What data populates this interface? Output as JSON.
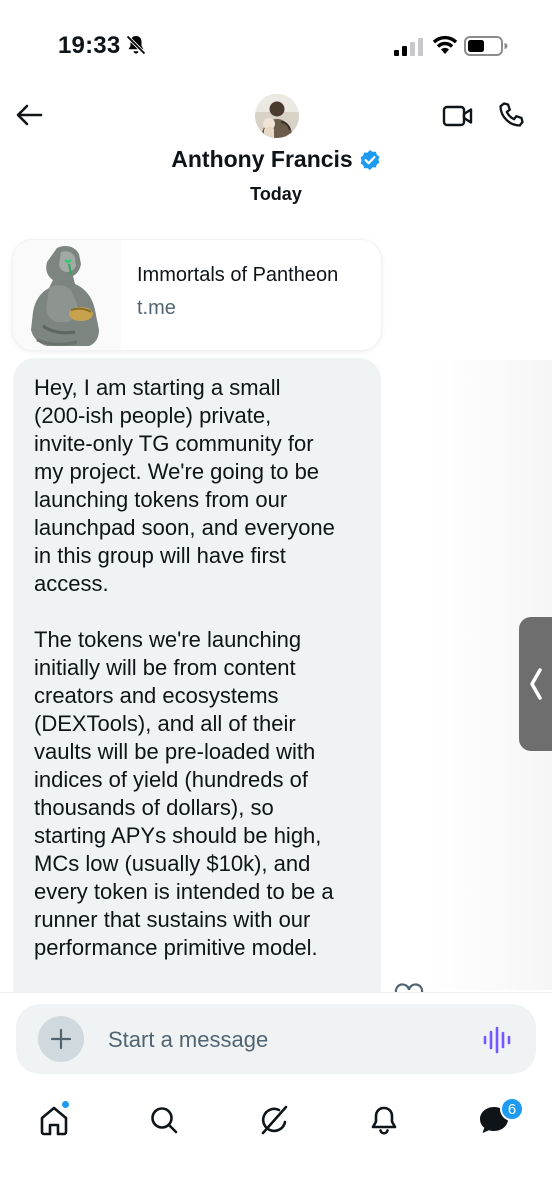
{
  "status_bar": {
    "time": "19:33"
  },
  "header": {
    "contact_name": "Anthony Francis",
    "date_label": "Today"
  },
  "link_card": {
    "title": "Immortals of Pantheon",
    "domain": "t.me"
  },
  "message": {
    "text": "Hey, I am starting a small\n(200-ish people) private,\ninvite-only TG community for\nmy project. We're going to be\nlaunching tokens from our\nlaunchpad soon, and everyone\nin this group will have first\naccess.\n\nThe tokens we're launching\ninitially will be from content\ncreators and ecosystems\n(DEXTools), and all of their\nvaults will be pre-loaded with\nindices of yield (hundreds of\nthousands of dollars), so\nstarting APYs should be high,\nMCs low (usually $10k), and\nevery token is intended to be a\nrunner that sustains with our\nperformance primitive model."
  },
  "composer": {
    "placeholder": "Start a message"
  },
  "nav": {
    "messages_badge": "6"
  },
  "colors": {
    "accent": "#1d9bf0",
    "bubble": "#eff3f4",
    "voice_icon": "#7856ff",
    "text": "#0f1419",
    "secondary_text": "#536471"
  },
  "icons": [
    "bell-off-icon",
    "signal-icon",
    "wifi-icon",
    "battery-icon",
    "back-arrow-icon",
    "verified-badge-icon",
    "video-icon",
    "phone-icon",
    "chevron-left-icon",
    "heart-icon",
    "plus-icon",
    "voice-wave-icon",
    "home-icon",
    "search-icon",
    "grok-icon",
    "notifications-icon",
    "messages-icon"
  ]
}
